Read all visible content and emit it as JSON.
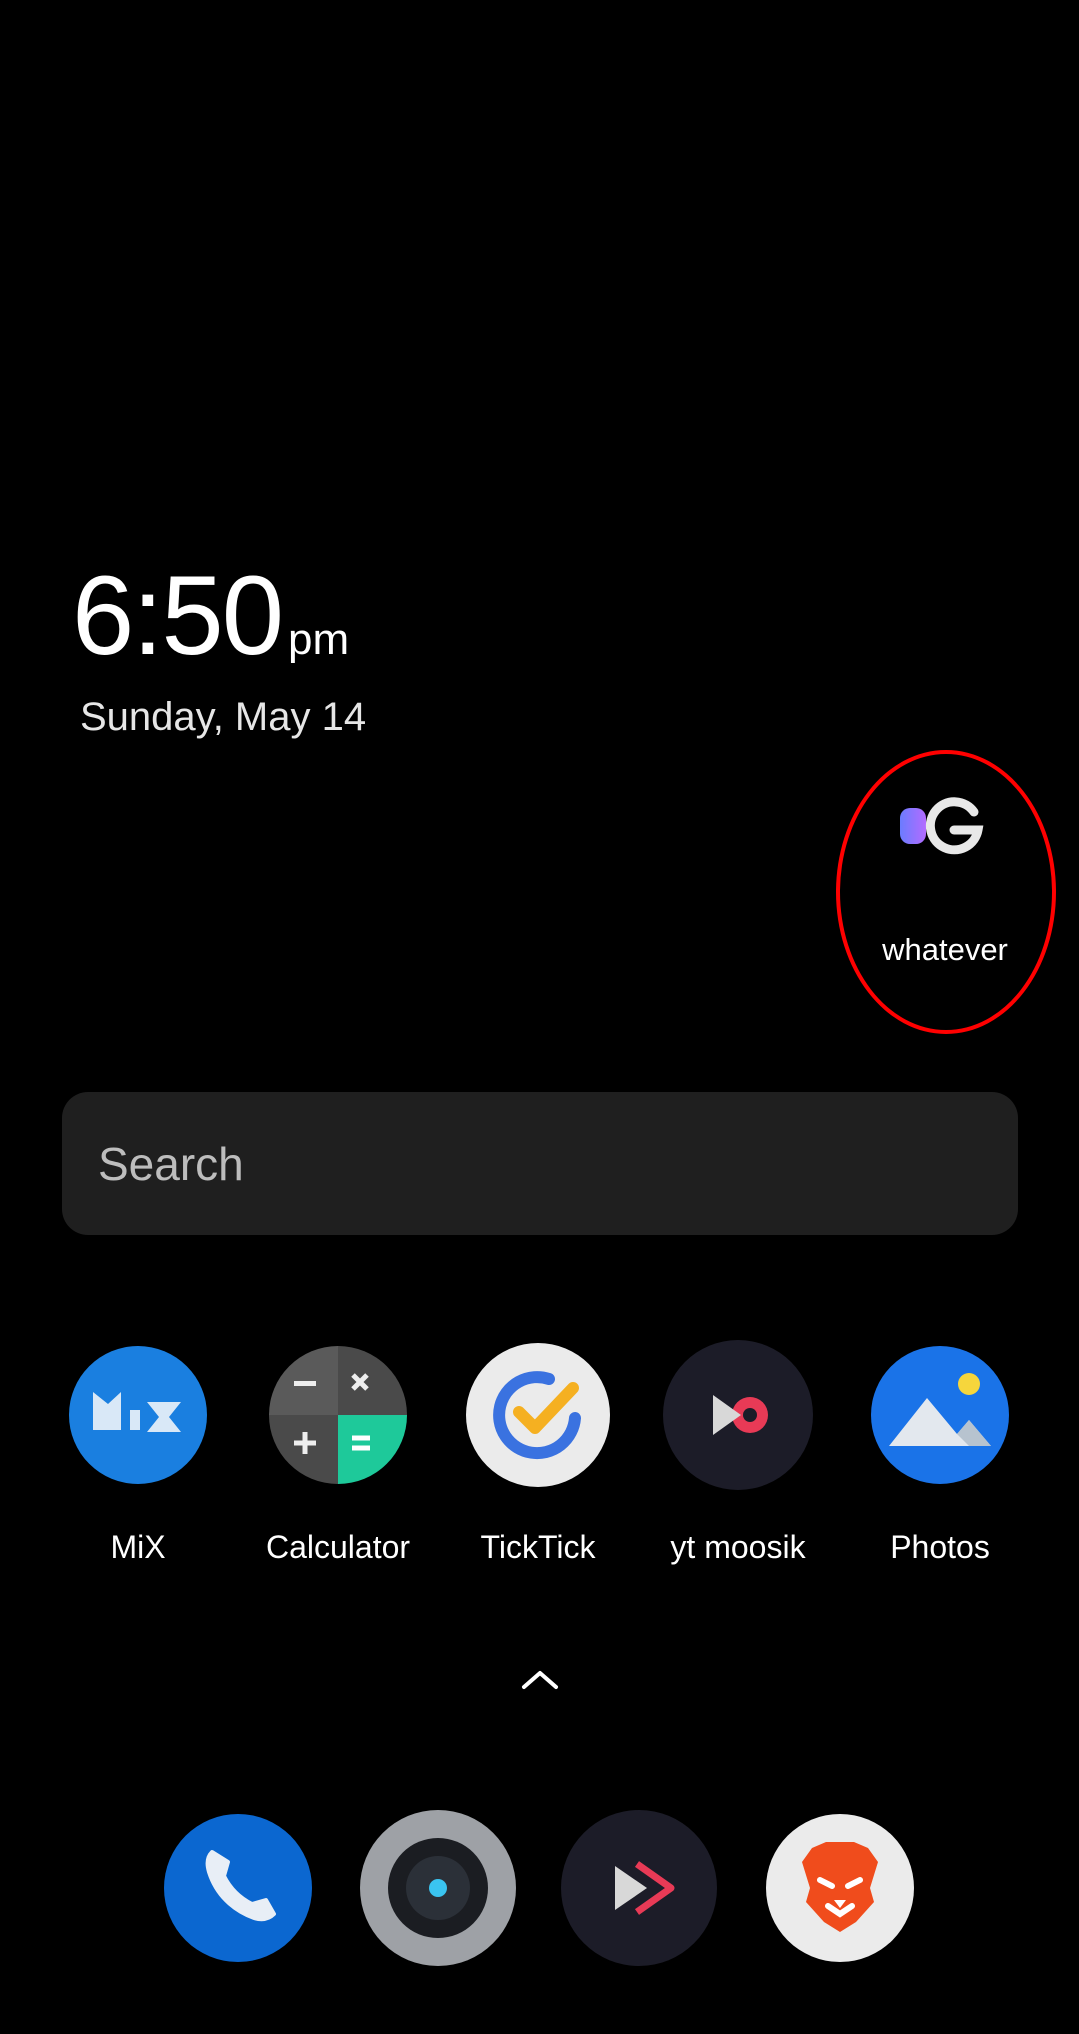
{
  "clock": {
    "time": "6:50",
    "ampm": "pm",
    "date": "Sunday, May 14"
  },
  "widget": {
    "label": "whatever",
    "icon": "google-g-icon",
    "highlight_color": "#ff0000"
  },
  "search": {
    "placeholder": "Search"
  },
  "apps": [
    {
      "label": "MiX",
      "icon": "mix-icon"
    },
    {
      "label": "Calculator",
      "icon": "calculator-icon"
    },
    {
      "label": "TickTick",
      "icon": "ticktick-icon"
    },
    {
      "label": "yt moosik",
      "icon": "yt-music-icon"
    },
    {
      "label": "Photos",
      "icon": "photos-icon"
    }
  ],
  "dock": [
    {
      "icon": "phone-icon"
    },
    {
      "icon": "camera-icon"
    },
    {
      "icon": "play-store-icon"
    },
    {
      "icon": "brave-browser-icon"
    }
  ],
  "colors": {
    "background": "#000000",
    "search_bg": "#1f1f1f",
    "accent_blue": "#1a73e8"
  }
}
